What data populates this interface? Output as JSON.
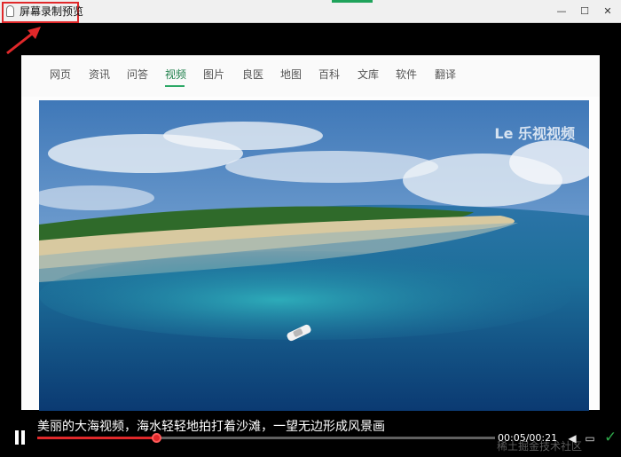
{
  "window": {
    "title": "屏幕录制预览",
    "min_glyph": "—",
    "max_glyph": "☐",
    "close_glyph": "✕"
  },
  "nav": {
    "items": [
      {
        "label": "网页"
      },
      {
        "label": "资讯"
      },
      {
        "label": "问答"
      },
      {
        "label": "视频",
        "active": true
      },
      {
        "label": "图片"
      },
      {
        "label": "良医"
      },
      {
        "label": "地图"
      },
      {
        "label": "百科"
      },
      {
        "label": "文库"
      },
      {
        "label": "软件"
      },
      {
        "label": "翻译"
      }
    ]
  },
  "video": {
    "watermark": "Le 乐视视频",
    "caption": "美丽的大海视频，海水轻轻地拍打着沙滩，一望无边形成风景画"
  },
  "player": {
    "progress": 0.26,
    "time": "00:05/00:21",
    "confirm_glyph": "✓"
  },
  "footer": {
    "corner_watermark": "稀土掘金技术社区"
  },
  "colors": {
    "accent_red": "#e0282a",
    "nav_active": "#2ca866",
    "confirm_green": "#2ea84a"
  }
}
